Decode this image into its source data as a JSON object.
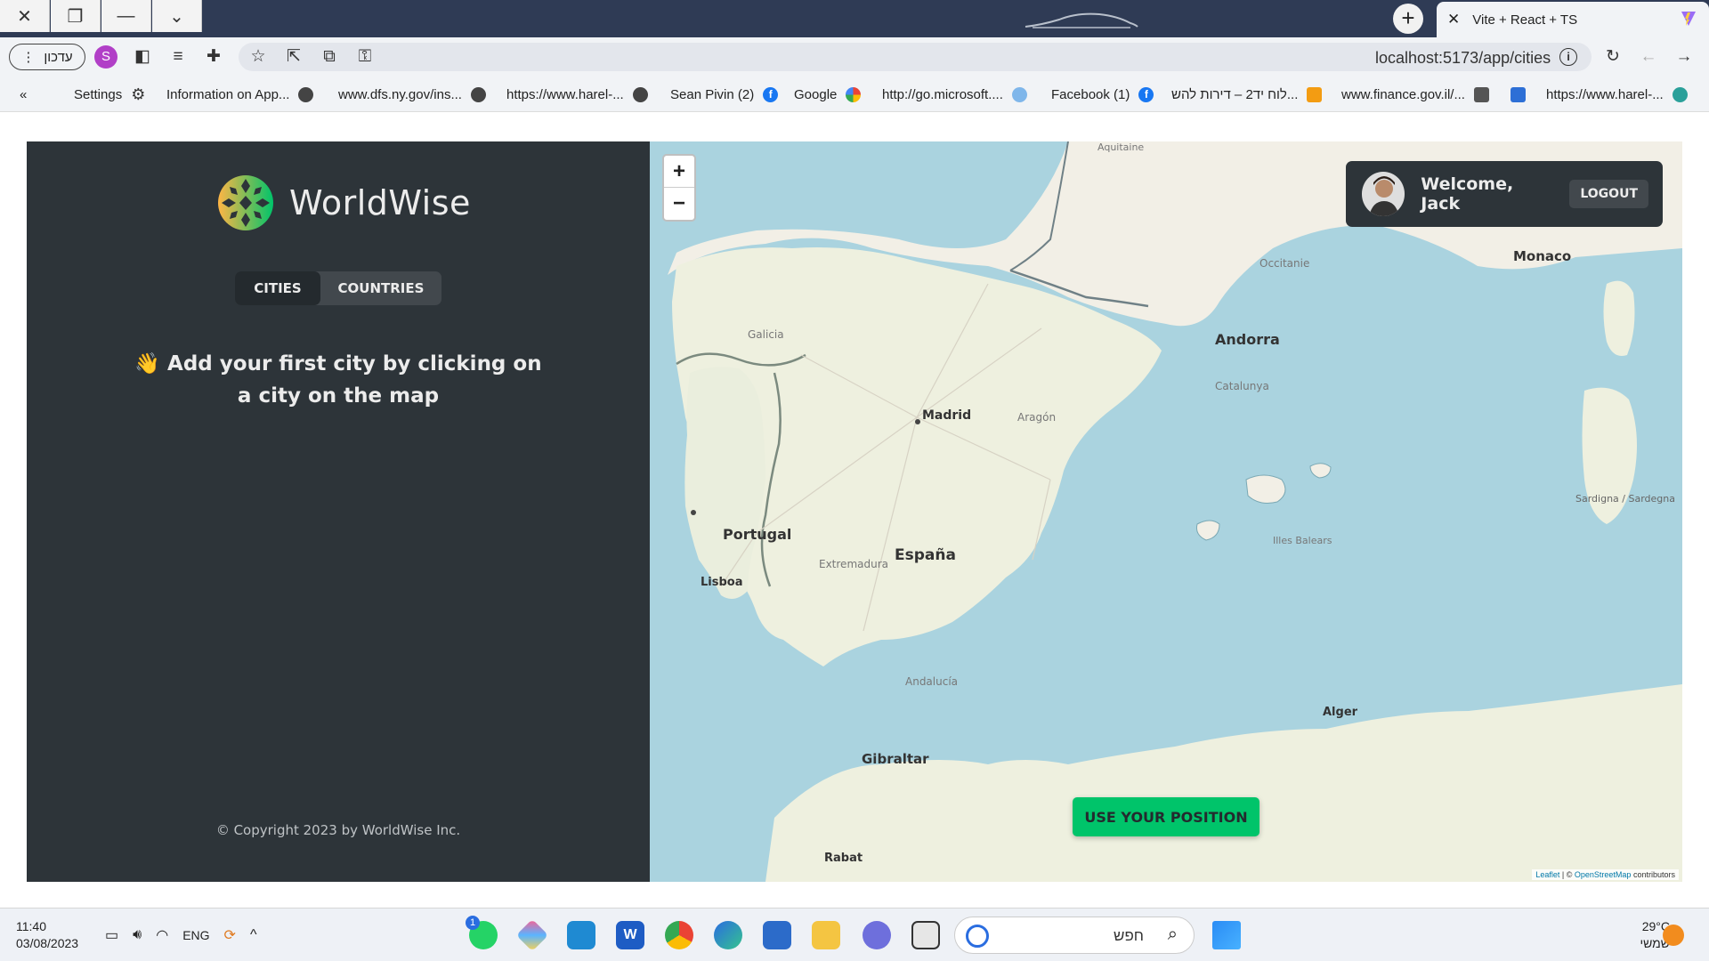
{
  "browser": {
    "window_controls": [
      "close",
      "restore",
      "minimize",
      "tabs-menu"
    ],
    "tab": {
      "title": "Vite + React + TS"
    },
    "profile_label": "עדכון",
    "profile_avatar": "S",
    "url": "localhost:5173/app/cities"
  },
  "bookmarks": {
    "collapse": "«",
    "items": [
      {
        "label": "Settings",
        "icon": "gear-icon"
      },
      {
        "label": "Information on App...",
        "icon": "globe-icon"
      },
      {
        "label": "www.dfs.ny.gov/ins...",
        "icon": "globe-icon"
      },
      {
        "label": "https://www.harel-...",
        "icon": "globe-icon"
      },
      {
        "label": "Sean Pivin (2)",
        "icon": "facebook-icon"
      },
      {
        "label": "Google",
        "icon": "google-icon"
      },
      {
        "label": "http://go.microsoft....",
        "icon": "microsoft-icon"
      },
      {
        "label": "Facebook (1)",
        "icon": "facebook-icon"
      },
      {
        "label": "לוח יד2 – דירות להש...",
        "icon": "yad2-icon"
      },
      {
        "label": "www.finance.gov.il/...",
        "icon": "finance-icon"
      },
      {
        "label": "",
        "icon": "fp-icon"
      },
      {
        "label": "https://www.harel-...",
        "icon": "edge-icon"
      }
    ]
  },
  "app": {
    "logo_text": "WorldWise",
    "tabs": [
      {
        "label": "CITIES",
        "active": true
      },
      {
        "label": "COUNTRIES",
        "active": false
      }
    ],
    "empty_message": "👋 Add your first city by clicking on a city on the map",
    "copyright": "© Copyright 2023 by WorldWise Inc.",
    "colors": {
      "sidebar": "#2d3439",
      "accent": "#00c46a",
      "map_water": "#aad3df"
    }
  },
  "map": {
    "zoom_in": "+",
    "zoom_out": "−",
    "user": {
      "welcome": "Welcome, Jack",
      "logout": "LOGOUT"
    },
    "use_position_button": "USE YOUR POSITION",
    "attribution": {
      "leaflet": "Leaflet",
      "osm": "OpenStreetMap",
      "rest": "contributors"
    },
    "labels": {
      "madrid": "Madrid",
      "espana": "España",
      "portugal": "Portugal",
      "lisboa": "Lisboa",
      "andorra": "Andorra",
      "monaco": "Monaco",
      "gibraltar": "Gibraltar",
      "alger": "Alger",
      "rabat": "Rabat",
      "galicia": "Galicia",
      "aragon": "Aragón",
      "catalunya": "Catalunya",
      "andalucia": "Andalucía",
      "extremadura": "Extremadura",
      "sardegna": "Sardigna / Sardegna",
      "occitanie": "Occitanie",
      "aquitaine": "Aquitaine",
      "baleares": "Illes Balears"
    }
  },
  "taskbar": {
    "time": "11:40",
    "date": "03/08/2023",
    "language": "ENG",
    "search_placeholder": "חפש",
    "weather_temp": "29°C",
    "weather_desc": "שמשי",
    "whatsapp_badge": "1"
  }
}
